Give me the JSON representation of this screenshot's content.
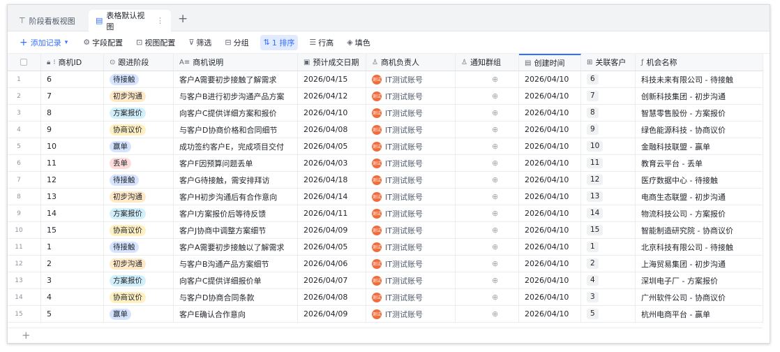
{
  "tabs": [
    {
      "label": "阶段看板视图",
      "icon": "kanban-icon"
    },
    {
      "label": "表格默认视图",
      "icon": "table-icon",
      "active": true
    }
  ],
  "toolbar": {
    "add_record": "添加记录",
    "field_config": "字段配置",
    "view_config": "视图配置",
    "filter": "筛选",
    "group": "分组",
    "sort": "1 排序",
    "row_height": "行高",
    "fill": "填色"
  },
  "columns": [
    "商机ID",
    "跟进阶段",
    "商机说明",
    "预计成交日期",
    "商机负责人",
    "通知群组",
    "创建时间",
    "关联客户",
    "机会名称"
  ],
  "stage_colors": {
    "待接触": {
      "bg": "#d6e4ff",
      "fg": "#1f2329"
    },
    "初步沟通": {
      "bg": "#ffe9c7",
      "fg": "#1f2329"
    },
    "方案报价": {
      "bg": "#d2f0fb",
      "fg": "#1f2329"
    },
    "协商议价": {
      "bg": "#fff0c2",
      "fg": "#1f2329"
    },
    "赢单": {
      "bg": "#d5e3ff",
      "fg": "#1f2329"
    },
    "丢单": {
      "bg": "#ffdcdc",
      "fg": "#1f2329"
    }
  },
  "owner_label": "IT测试账号",
  "avatar_text": "测试",
  "rows": [
    {
      "no": "1",
      "id": "6",
      "stage": "待接触",
      "desc": "客户A需要初步接触了解需求",
      "date": "2026/04/15",
      "created": "2026/04/10",
      "rel": "6",
      "name": "科技未来有限公司 - 待接触"
    },
    {
      "no": "2",
      "id": "7",
      "stage": "初步沟通",
      "desc": "与客户B进行初步沟通产品方案",
      "date": "2026/04/12",
      "created": "2026/04/10",
      "rel": "7",
      "name": "创新科技集团 - 初步沟通"
    },
    {
      "no": "3",
      "id": "8",
      "stage": "方案报价",
      "desc": "向客户C提供详细方案和报价",
      "date": "2026/04/10",
      "created": "2026/04/10",
      "rel": "8",
      "name": "智慧零售股份 - 方案报价"
    },
    {
      "no": "4",
      "id": "9",
      "stage": "协商议价",
      "desc": "与客户D协商价格和合同细节",
      "date": "2026/04/08",
      "created": "2026/04/10",
      "rel": "9",
      "name": "绿色能源科技 - 协商议价"
    },
    {
      "no": "5",
      "id": "10",
      "stage": "赢单",
      "desc": "成功签约客户E，完成项目交付",
      "date": "2026/04/05",
      "created": "2026/04/10",
      "rel": "10",
      "name": "金融科技联盟 - 赢单"
    },
    {
      "no": "6",
      "id": "11",
      "stage": "丢单",
      "desc": "客户F因预算问题丢单",
      "date": "2026/04/03",
      "created": "2026/04/10",
      "rel": "11",
      "name": "教育云平台 - 丢单"
    },
    {
      "no": "7",
      "id": "12",
      "stage": "待接触",
      "desc": "客户G待接触，需安排拜访",
      "date": "2026/04/18",
      "created": "2026/04/10",
      "rel": "12",
      "name": "医疗数据中心 - 待接触"
    },
    {
      "no": "8",
      "id": "13",
      "stage": "初步沟通",
      "desc": "客户H初步沟通后有合作意向",
      "date": "2026/04/14",
      "created": "2026/04/10",
      "rel": "13",
      "name": "电商生态联盟 - 初步沟通"
    },
    {
      "no": "9",
      "id": "14",
      "stage": "方案报价",
      "desc": "客户I方案报价后等待反馈",
      "date": "2026/04/11",
      "created": "2026/04/10",
      "rel": "14",
      "name": "物流科技公司 - 方案报价"
    },
    {
      "no": "10",
      "id": "15",
      "stage": "协商议价",
      "desc": "客户J协商中调整方案细节",
      "date": "2026/04/09",
      "created": "2026/04/10",
      "rel": "15",
      "name": "智能制造研究院 - 协商议价"
    },
    {
      "no": "11",
      "id": "1",
      "stage": "待接触",
      "desc": "客户A需要初步接触以了解需求",
      "date": "2026/04/05",
      "created": "2026/04/10",
      "rel": "1",
      "name": "北京科技有限公司 - 待接触"
    },
    {
      "no": "12",
      "id": "2",
      "stage": "初步沟通",
      "desc": "与客户B沟通产品方案细节",
      "date": "2026/04/06",
      "created": "2026/04/10",
      "rel": "2",
      "name": "上海贸易集团 - 初步沟通"
    },
    {
      "no": "13",
      "id": "3",
      "stage": "方案报价",
      "desc": "向客户C提供详细报价单",
      "date": "2026/04/07",
      "created": "2026/04/10",
      "rel": "4",
      "name": "深圳电子厂 - 方案报价"
    },
    {
      "no": "14",
      "id": "4",
      "stage": "协商议价",
      "desc": "与客户D协商合同条款",
      "date": "2026/04/08",
      "created": "2026/04/10",
      "rel": "3",
      "name": "广州软件公司 - 协商议价"
    },
    {
      "no": "15",
      "id": "5",
      "stage": "赢单",
      "desc": "客户E确认合作意向",
      "date": "2026/04/09",
      "created": "2026/04/10",
      "rel": "5",
      "name": "杭州电商平台 - 赢单"
    }
  ]
}
